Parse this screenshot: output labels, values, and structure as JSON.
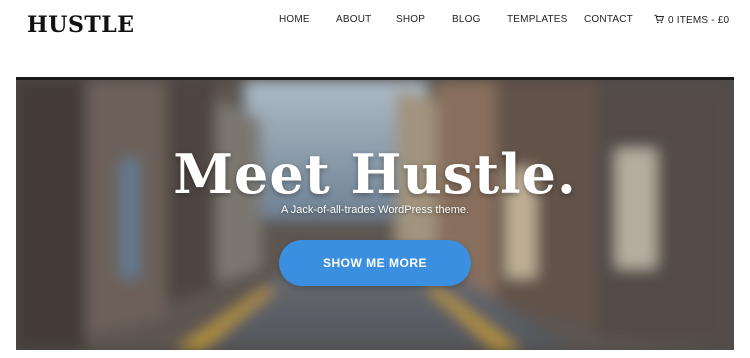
{
  "brand": {
    "logo": "HUSTLE"
  },
  "nav": {
    "items": [
      {
        "label": "HOME"
      },
      {
        "label": "ABOUT"
      },
      {
        "label": "SHOP"
      },
      {
        "label": "BLOG"
      },
      {
        "label": "TEMPLATES"
      },
      {
        "label": "CONTACT"
      }
    ],
    "cart": {
      "icon": "cart-icon",
      "label": "0 ITEMS - £0"
    }
  },
  "hero": {
    "title": "Meet Hustle.",
    "subtitle": "A Jack-of-all-trades WordPress theme.",
    "cta_label": "SHOW ME MORE",
    "cta_color": "#3a8fe0"
  }
}
